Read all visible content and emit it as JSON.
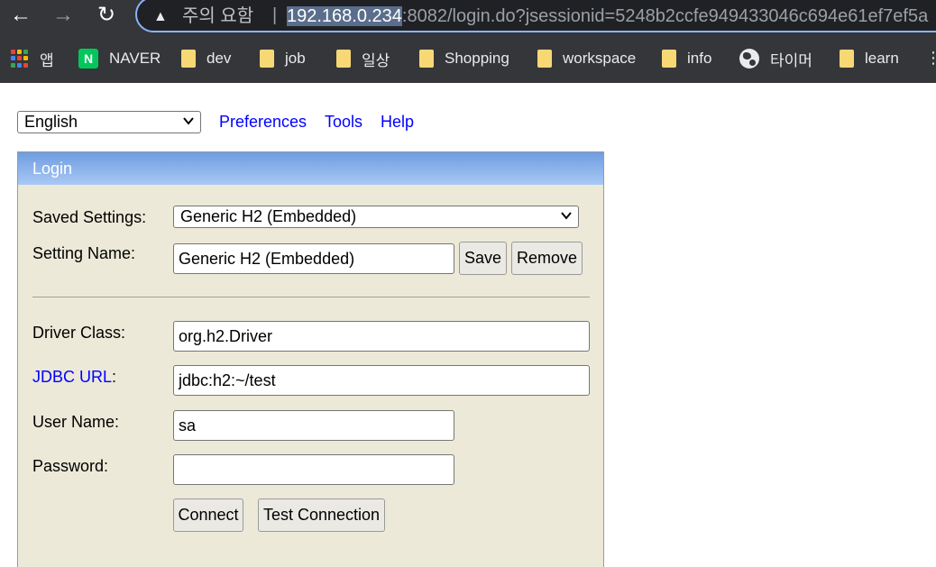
{
  "browser": {
    "security_warning": "주의 요함",
    "url_host": "192.168.0.234",
    "url_rest": ":8082/login.do?jsessionid=5248b2ccfe949433046c694e61ef7ef5a",
    "bookmarks": [
      {
        "label": "앱",
        "icon": "apps-icon"
      },
      {
        "label": "NAVER",
        "icon": "naver-icon"
      },
      {
        "label": "dev",
        "icon": "folder-icon"
      },
      {
        "label": "job",
        "icon": "folder-icon"
      },
      {
        "label": "일상",
        "icon": "folder-icon"
      },
      {
        "label": "Shopping",
        "icon": "folder-icon"
      },
      {
        "label": "workspace",
        "icon": "folder-icon"
      },
      {
        "label": "info",
        "icon": "folder-icon"
      },
      {
        "label": "타이머",
        "icon": "globe-icon"
      },
      {
        "label": "learn",
        "icon": "folder-icon"
      }
    ]
  },
  "toolbar": {
    "language": "English",
    "preferences": "Preferences",
    "tools": "Tools",
    "help": "Help"
  },
  "login": {
    "header": "Login",
    "saved_settings_label": "Saved Settings:",
    "saved_settings_value": "Generic H2 (Embedded)",
    "setting_name_label": "Setting Name:",
    "setting_name_value": "Generic H2 (Embedded)",
    "save_label": "Save",
    "remove_label": "Remove",
    "driver_class_label": "Driver Class:",
    "driver_class_value": "org.h2.Driver",
    "jdbc_url_link": "JDBC URL",
    "colon": ":",
    "jdbc_url_value": "jdbc:h2:~/test",
    "user_name_label": "User Name:",
    "user_name_value": "sa",
    "password_label": "Password:",
    "password_value": "",
    "connect_label": "Connect",
    "test_connection_label": "Test Connection"
  },
  "colors": {
    "link": "#0000ff",
    "panel_bg": "#ece9d8",
    "header_blue": "#6e9de0"
  }
}
